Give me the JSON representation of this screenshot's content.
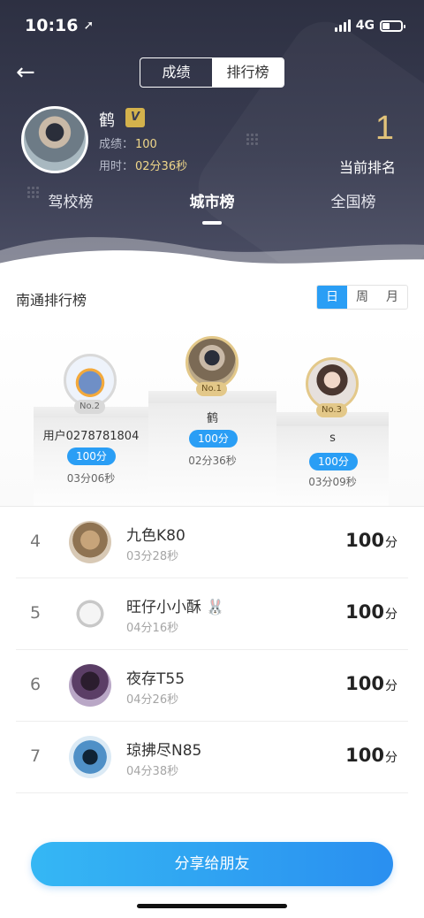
{
  "status": {
    "time": "10:16",
    "network": "4G"
  },
  "header": {
    "segment": [
      "成绩",
      "排行榜"
    ],
    "active_segment": 1,
    "user": {
      "name": "鹤",
      "vip": "V",
      "score_label": "成绩：",
      "score": "100",
      "time_label": "用时：",
      "time": "02分36秒"
    },
    "rank": "1",
    "rank_label": "当前排名",
    "tabs": [
      "驾校榜",
      "城市榜",
      "全国榜"
    ],
    "active_tab": 1
  },
  "board": {
    "title": "南通排行榜",
    "periods": [
      "日",
      "周",
      "月"
    ],
    "active_period": 0
  },
  "podium": {
    "first": {
      "badge": "No.1",
      "name": "鹤",
      "score": "100分",
      "time": "02分36秒"
    },
    "second": {
      "badge": "No.2",
      "name": "用户0278781804",
      "score": "100分",
      "time": "03分06秒"
    },
    "third": {
      "badge": "No.3",
      "name": "s",
      "score": "100分",
      "time": "03分09秒"
    }
  },
  "list": [
    {
      "rank": "4",
      "name": "九色K80",
      "time": "03分28秒",
      "score": "100",
      "unit": "分"
    },
    {
      "rank": "5",
      "name": "旺仔小小酥",
      "time": "04分16秒",
      "score": "100",
      "unit": "分"
    },
    {
      "rank": "6",
      "name": "夜存T55",
      "time": "04分26秒",
      "score": "100",
      "unit": "分"
    },
    {
      "rank": "7",
      "name": "琼拂尽N85",
      "time": "04分38秒",
      "score": "100",
      "unit": "分"
    }
  ],
  "share_label": "分享给朋友",
  "colors": {
    "accent": "#2a9ef5",
    "gold": "#e2c37a",
    "header_bg": "#2d3042"
  }
}
